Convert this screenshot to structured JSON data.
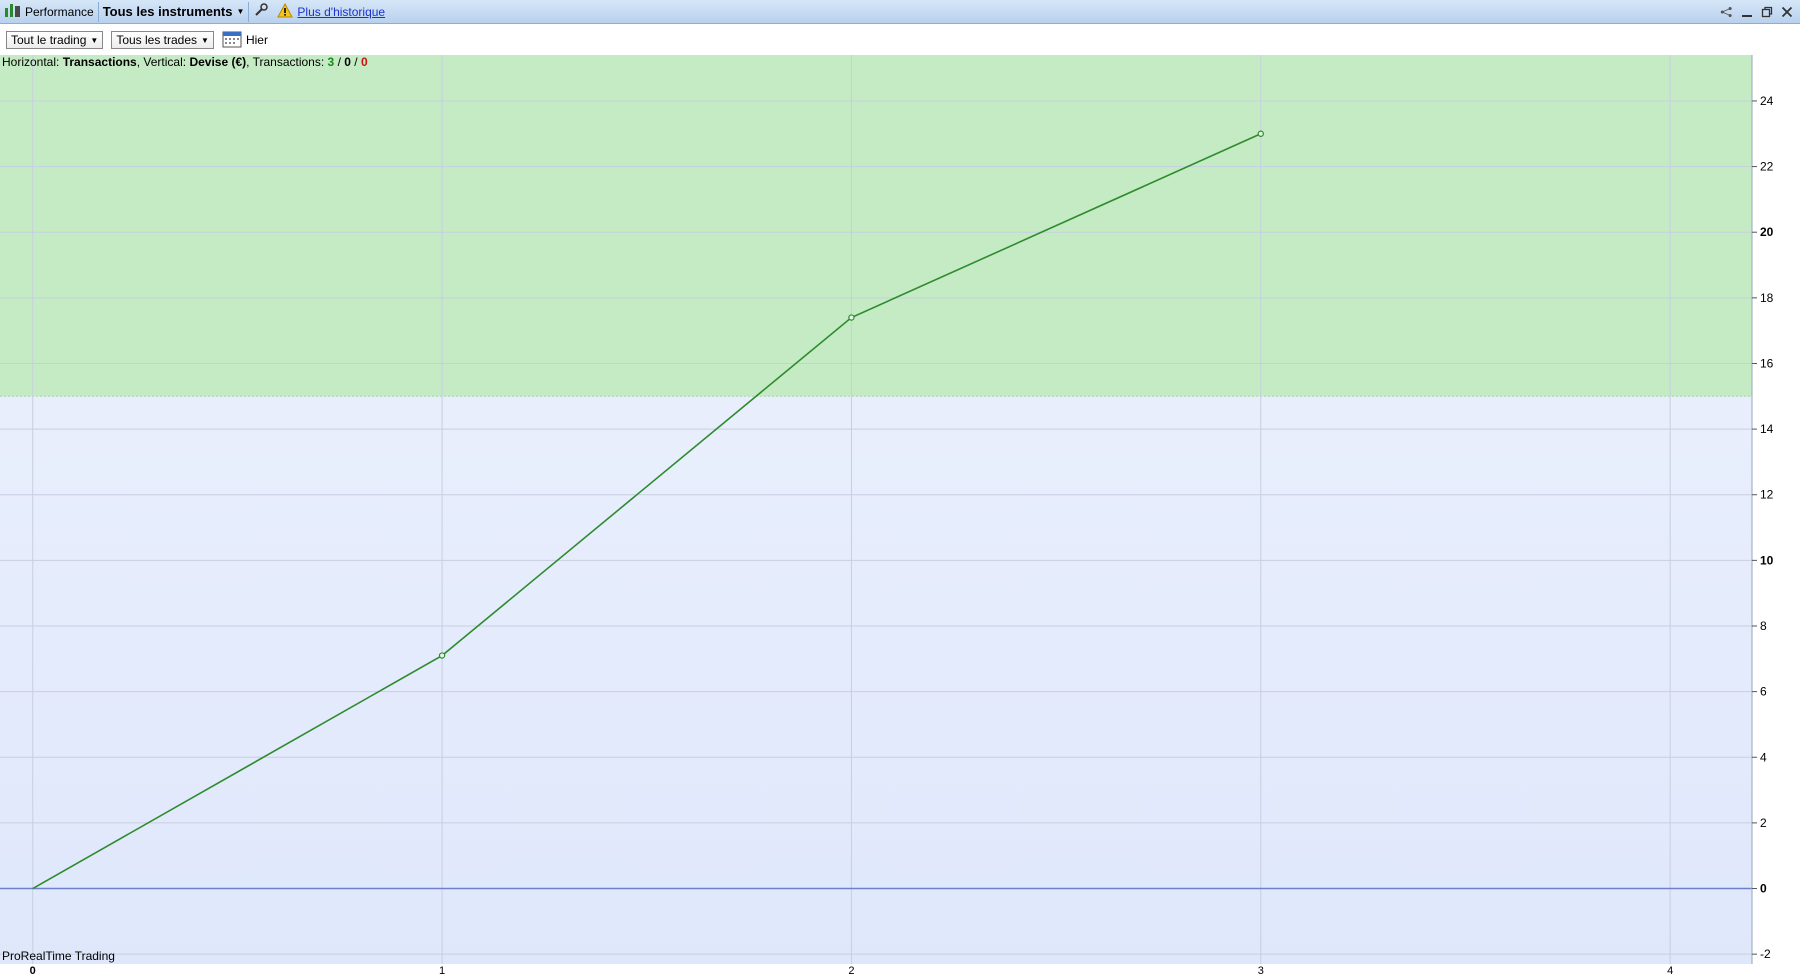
{
  "titlebar": {
    "title": "Performance",
    "instrument": "Tous les instruments",
    "history_link": "Plus d'historique",
    "icons": [
      "performance-icon",
      "wrench-icon",
      "warning-icon",
      "share-icon",
      "minimize-icon",
      "restore-icon",
      "close-icon"
    ]
  },
  "toolbar": {
    "scope_select": "Tout le trading",
    "trades_select": "Tous les trades",
    "date_label": "Hier"
  },
  "info": {
    "horizontal_label": "Horizontal:",
    "horizontal_value": "Transactions",
    "vertical_label": ", Vertical:",
    "vertical_value": "Devise (€)",
    "transactions_label": ", Transactions:",
    "winning": "3",
    "neutral": "0",
    "losing": "0",
    "slash": "/"
  },
  "brand": "ProRealTime Trading",
  "colors": {
    "line": "#2e8b2e",
    "profit_zone": "#c5ebc5",
    "background_top": "#eef3fd",
    "background_bottom": "#dfe7fb",
    "zero_line": "#6f7fd0",
    "titlebar": "#c9dcf3"
  },
  "chart_data": {
    "type": "line",
    "x": [
      0,
      1,
      2,
      3
    ],
    "values": [
      0,
      7.1,
      17.4,
      23.0
    ],
    "xlim": [
      -0.08,
      4.2
    ],
    "ylim": [
      -2.3,
      25.4
    ],
    "x_ticks": [
      0,
      1,
      2,
      3,
      4
    ],
    "y_ticks": [
      -2,
      0,
      2,
      4,
      6,
      8,
      10,
      12,
      14,
      16,
      18,
      20,
      22,
      24
    ],
    "bold_y_ticks": [
      0,
      10,
      20
    ],
    "highlight_band": [
      15,
      25.4
    ],
    "grid": true,
    "zero_line": true
  }
}
